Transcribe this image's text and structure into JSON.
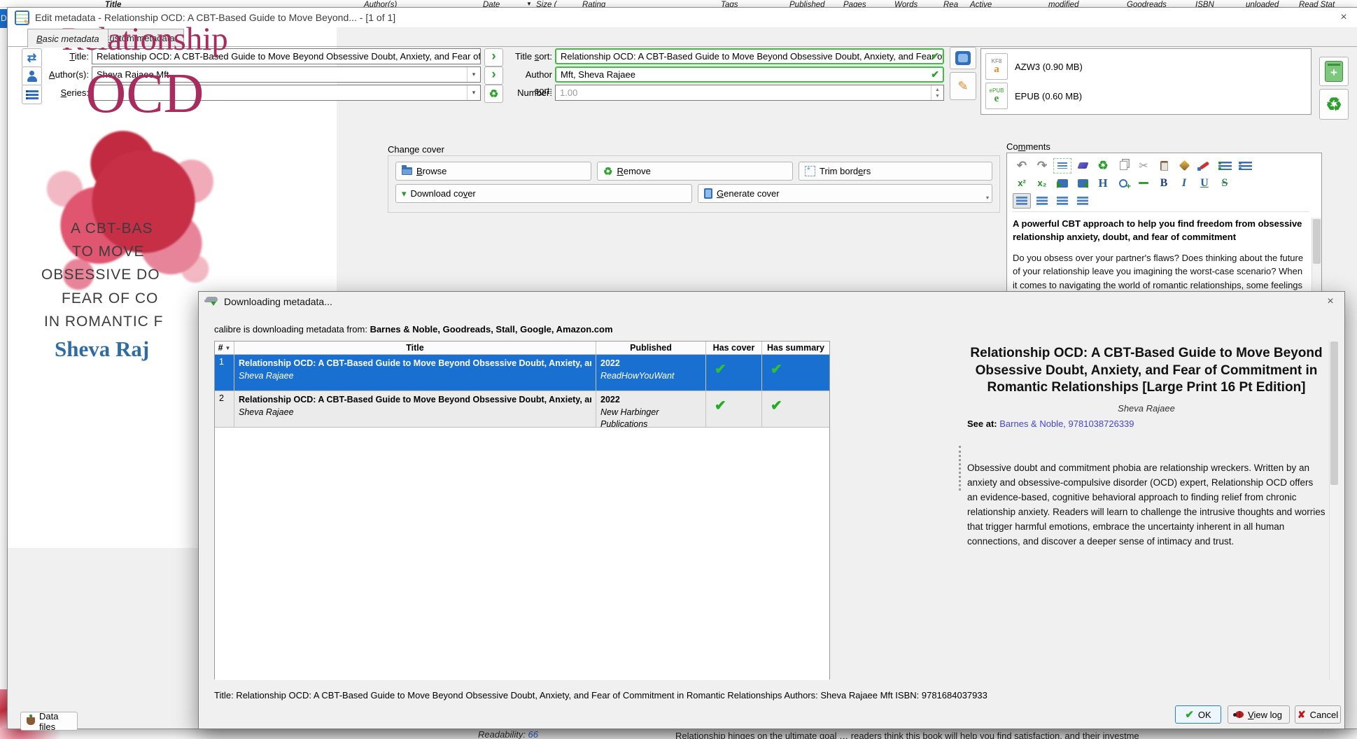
{
  "icons": {
    "check": "✔",
    "cross": "✘",
    "close": "×",
    "chevron": "›",
    "down_arrow": "▾",
    "sort_indicator": "▼",
    "recycle": "♻",
    "pencil": "✎",
    "comments_toolbar": [
      "undo",
      "redo",
      "select-all",
      "eraser",
      "clear-formatting",
      "copy",
      "cut",
      "paste",
      "fill-color",
      "brush-color",
      "ordered-list",
      "unordered-list",
      "superscript",
      "subscript",
      "indent",
      "outdent",
      "heading",
      "insert-link",
      "horizontal-rule",
      "bold",
      "italic",
      "underline",
      "strikethrough",
      "align-left",
      "align-center",
      "align-right",
      "align-justify"
    ]
  },
  "background": {
    "columns": [
      "Title",
      "Author(s)",
      "Date",
      "Size (",
      "Rating",
      "Tags",
      "Published",
      "Pages",
      "Words",
      "Rea",
      "Active",
      "modified",
      "Goodreads",
      "ISBN",
      "unloaded",
      "Read Stat"
    ],
    "selected_row_fragment": "D: A",
    "readability_label": "Readability: ",
    "readability_value": "66",
    "bottom_text": "Relationship hinges on the ultimate goal … readers think this book will help you find satisfaction, and their investme"
  },
  "edit_dialog": {
    "title": "Edit metadata - Relationship OCD: A CBT-Based Guide to Move Beyond... -  [1 of 1]",
    "tabs": {
      "basic_html": "<u>B</u>asic metadata",
      "custom_html": "<u>C</u>ustom metadata"
    },
    "form": {
      "title_label_html": "<u>T</u>itle:",
      "title_value": "Relationship OCD: A CBT-Based Guide to Move Beyond Obsessive Doubt, Anxiety, and Fear of Commitme",
      "title_sort_label_html": "Title <u>s</u>ort:",
      "title_sort_value": "Relationship OCD: A CBT-Based Guide to Move Beyond Obsessive Doubt, Anxiety, and Fear of Comr",
      "authors_label_html": "<u>A</u>uthor(s):",
      "authors_value": "Sheva Rajaee Mft",
      "author_sort_label_html": "Author s<u>o</u>rt:",
      "author_sort_value": "Mft, Sheva Rajaee",
      "series_label_html": "<u>S</u>eries:",
      "series_value": "",
      "number_label": "Number:",
      "number_value": "1.00"
    },
    "formats": {
      "azw3_badge": "KF8",
      "azw3_glyph": "a",
      "azw3_label": "AZW3 (0.90 MB)",
      "epub_badge": "ePUB",
      "epub_glyph": "e",
      "epub_label": "EPUB (0.60 MB)"
    },
    "change_cover": {
      "label": "Change cover",
      "browse_html": "<u>B</u>rowse",
      "remove_html": "<u>R</u>emove",
      "trim_html": "Trim bord<u>e</u>rs",
      "download_html": "Download co<u>v</u>er",
      "generate_html": "<u>G</u>enerate cover"
    },
    "comments": {
      "label_html": "Co<u>m</u>ments",
      "heading": "A powerful CBT approach to help you find freedom from obsessive relationship anxiety, doubt, and fear of commitment",
      "body": "Do you obsess over your partner's flaws? Does thinking about the future of your relationship leave you imagining the worst-case scenario? When it comes to navigating the world of romantic relationships, some feelings of"
    },
    "cover": {
      "title_line1": "Relationship",
      "title_line2": "OCD",
      "line1": "A CBT-BAS",
      "line2": "TO MOVE",
      "line3": "OBSESSIVE DO",
      "line4": "FEAR OF CO",
      "line5": "IN ROMANTIC F",
      "author": "Sheva Raj"
    },
    "data_files_label": "Data files"
  },
  "download_dialog": {
    "title": "Downloading metadata...",
    "source_prefix": "calibre is downloading metadata from: ",
    "sources": "Barnes & Noble, Goodreads, Stall, Google, Amazon.com",
    "table": {
      "col_num": "#",
      "col_title": "Title",
      "col_published": "Published",
      "col_has_cover": "Has cover",
      "col_has_summary": "Has summary",
      "rows": [
        {
          "num": "1",
          "title": "Relationship OCD: A CBT-Based Guide to Move Beyond Obsessive Doubt, Anxiety, and Fear",
          "author": "Sheva Rajaee",
          "year": "2022",
          "publisher": "ReadHowYouWant"
        },
        {
          "num": "2",
          "title": "Relationship OCD: A CBT-Based Guide to Move Beyond Obsessive Doubt, Anxiety, and Fear",
          "author": "Sheva Rajaee",
          "year": "2022",
          "publisher": "New Harbinger Publications"
        }
      ]
    },
    "detail": {
      "title": "Relationship OCD: A CBT-Based Guide to Move Beyond Obsessive Doubt, Anxiety, and Fear of Commitment in Romantic Relationships [Large Print 16 Pt Edition]",
      "author": "Sheva Rajaee",
      "see_at_label": "See at: ",
      "see_at_links": "Barnes & Noble, 9781038726339",
      "description": "Obsessive doubt and commitment phobia are relationship wreckers. Written by an anxiety and obsessive-compulsive disorder (OCD) expert, Relationship OCD offers an evidence-based, cognitive behavioral approach to finding relief from chronic relationship anxiety. Readers will learn to challenge the intrusive thoughts and worries that trigger harmful emotions, embrace the uncertainty inherent in all human connections, and discover a deeper sense of intimacy and trust."
    },
    "status_text": "Title: Relationship OCD: A CBT-Based Guide to Move Beyond Obsessive Doubt, Anxiety, and Fear of Commitment in Romantic Relationships Authors: Sheva Rajaee Mft ISBN: 9781684037933",
    "ok_label": "OK",
    "view_log_label_html": "<u>V</u>iew log",
    "cancel_label": "Cancel"
  },
  "colors": {
    "selection_blue": "#1a70d0",
    "valid_green": "#3fbf3f",
    "link_blue": "#4444dd",
    "cover_magenta": "#a82c5e",
    "cover_author_blue": "#2e6da4"
  }
}
